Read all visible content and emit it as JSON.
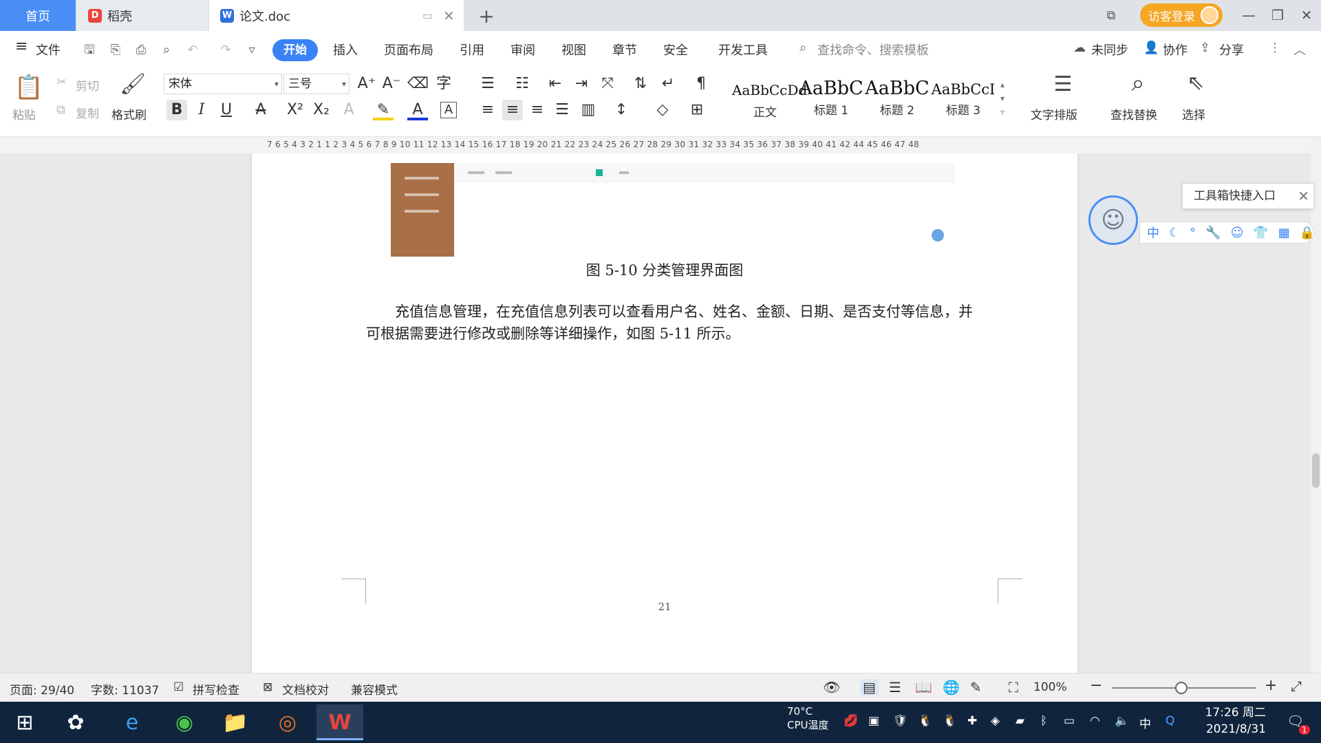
{
  "titlebar": {
    "tabs": [
      {
        "label": "首页"
      },
      {
        "label": "稻壳"
      },
      {
        "label": "论文.doc"
      }
    ],
    "login_label": "访客登录"
  },
  "menu": {
    "file_label": "文件",
    "items": [
      "开始",
      "插入",
      "页面布局",
      "引用",
      "审阅",
      "视图",
      "章节",
      "安全",
      "开发工具"
    ],
    "search_placeholder": "查找命令、搜索模板",
    "sync_label": "未同步",
    "collab_label": "协作",
    "share_label": "分享"
  },
  "ribbon": {
    "paste_label": "粘贴",
    "cut_label": "剪切",
    "copy_label": "复制",
    "format_painter_label": "格式刷",
    "font_name": "宋体",
    "font_size": "三号",
    "styles": [
      {
        "sample": "AaBbCcDd",
        "name": "正文"
      },
      {
        "sample": "AaBbC",
        "name": "标题 1"
      },
      {
        "sample": "AaBbC",
        "name": "标题 2"
      },
      {
        "sample": "AaBbCcI",
        "name": "标题 3"
      }
    ],
    "text_layout_label": "文字排版",
    "find_replace_label": "查找替换",
    "select_label": "选择"
  },
  "ruler": {
    "ticks": "7  6  5  4  3  2  1       1  2  3  4  5  6  7  8  9  10 11 12 13 14 15 16 17 18 19 20 21 22 23 24 25 26 27 28 29 30 31 32 33 34 35 36 37 38 39 40 41 42    44 45 46 47 48"
  },
  "document": {
    "figure_caption": "图 5-10 分类管理界面图",
    "paragraph": "充值信息管理，在充值信息列表可以查看用户名、姓名、金额、日期、是否支付等信息，并可根据需要进行修改或删除等详细操作，如图 5-11 所示。",
    "page_number": "21"
  },
  "assistant": {
    "toolbox_label": "工具箱快捷入口",
    "bar_char": "中"
  },
  "statusbar": {
    "page": "页面: 29/40",
    "word_count": "字数: 11037",
    "spell_check": "拼写检查",
    "doc_proof": "文档校对",
    "compat_mode": "兼容模式",
    "zoom": "100%"
  },
  "taskbar": {
    "cpu_temp": "70°C",
    "cpu_label": "CPU温度",
    "ime": "中",
    "time": "17:26 周二",
    "date": "2021/8/31",
    "notification_count": "1"
  },
  "colors": {
    "accent": "#3b82f6",
    "login": "#f5a623",
    "taskbar": "#10243d"
  }
}
